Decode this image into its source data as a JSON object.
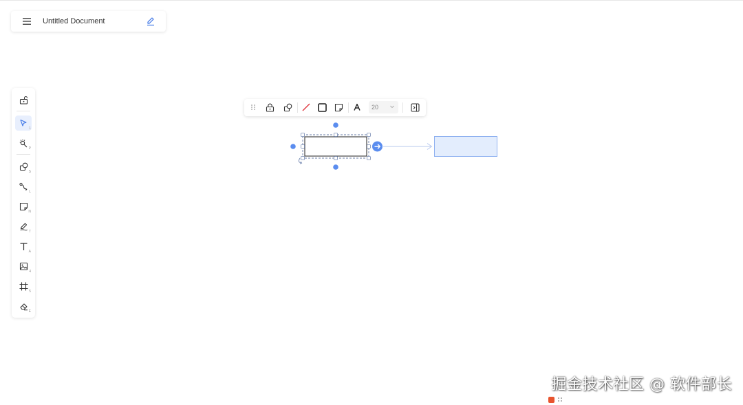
{
  "header": {
    "menu_icon": "hamburger-icon",
    "title": "Untitled Document",
    "edit_icon": "pencil-icon"
  },
  "toolbox": {
    "items": [
      {
        "name": "lock-icon",
        "key": ""
      },
      {
        "name": "select-icon",
        "key": "1",
        "active": true
      },
      {
        "name": "laser-pointer-icon",
        "key": "P"
      },
      {
        "name": "shape-icon",
        "key": "S"
      },
      {
        "name": "connector-icon",
        "key": "L"
      },
      {
        "name": "sticky-note-icon",
        "key": "N"
      },
      {
        "name": "pen-icon",
        "key": "T"
      },
      {
        "name": "text-icon",
        "key": "A"
      },
      {
        "name": "image-icon",
        "key": "4"
      },
      {
        "name": "frame-icon",
        "key": "5"
      },
      {
        "name": "eraser-icon",
        "key": "E"
      }
    ]
  },
  "floating_toolbar": {
    "items": [
      "drag-handle-icon",
      "lock-icon",
      "shape-icon",
      "stroke-color-icon",
      "fill-icon",
      "sticky-note-icon",
      "font-icon",
      "panel-toggle-icon"
    ],
    "font_size": "20",
    "accent": "#4f7ae8",
    "stroke_color": "#e0323b"
  },
  "canvas": {
    "selected_shape_color": "#5b8def",
    "target_fill": "#e3edfd",
    "target_stroke": "#8fb1f0"
  },
  "watermark": {
    "text": "掘金技术社区 @ 软件部长"
  }
}
